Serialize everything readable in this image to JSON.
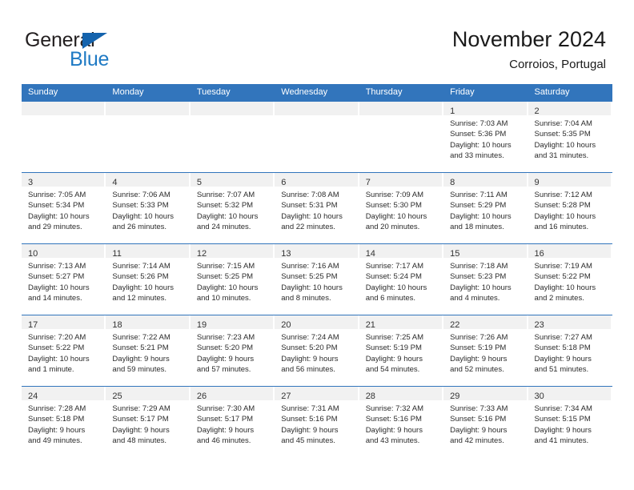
{
  "brand": {
    "name_top": "General",
    "name_bottom": "Blue",
    "triangle_icon": "triangle-icon",
    "color_dark": "#231f20",
    "color_blue": "#1f7ac4"
  },
  "header": {
    "title": "November 2024",
    "subtitle": "Corroios, Portugal"
  },
  "theme": {
    "header_bg": "#3275bc",
    "daynum_bg": "#f1f1f1",
    "cell_bg": "#ffffff",
    "row_divider": "#3275bc",
    "text": "#2b2b2b"
  },
  "weekday_headers": [
    "Sunday",
    "Monday",
    "Tuesday",
    "Wednesday",
    "Thursday",
    "Friday",
    "Saturday"
  ],
  "weeks": [
    [
      {
        "day": "",
        "sunrise": "",
        "sunset": "",
        "daylight_line1": "",
        "daylight_line2": "",
        "empty": true
      },
      {
        "day": "",
        "sunrise": "",
        "sunset": "",
        "daylight_line1": "",
        "daylight_line2": "",
        "empty": true
      },
      {
        "day": "",
        "sunrise": "",
        "sunset": "",
        "daylight_line1": "",
        "daylight_line2": "",
        "empty": true
      },
      {
        "day": "",
        "sunrise": "",
        "sunset": "",
        "daylight_line1": "",
        "daylight_line2": "",
        "empty": true
      },
      {
        "day": "",
        "sunrise": "",
        "sunset": "",
        "daylight_line1": "",
        "daylight_line2": "",
        "empty": true
      },
      {
        "day": "1",
        "sunrise": "Sunrise: 7:03 AM",
        "sunset": "Sunset: 5:36 PM",
        "daylight_line1": "Daylight: 10 hours",
        "daylight_line2": "and 33 minutes."
      },
      {
        "day": "2",
        "sunrise": "Sunrise: 7:04 AM",
        "sunset": "Sunset: 5:35 PM",
        "daylight_line1": "Daylight: 10 hours",
        "daylight_line2": "and 31 minutes."
      }
    ],
    [
      {
        "day": "3",
        "sunrise": "Sunrise: 7:05 AM",
        "sunset": "Sunset: 5:34 PM",
        "daylight_line1": "Daylight: 10 hours",
        "daylight_line2": "and 29 minutes."
      },
      {
        "day": "4",
        "sunrise": "Sunrise: 7:06 AM",
        "sunset": "Sunset: 5:33 PM",
        "daylight_line1": "Daylight: 10 hours",
        "daylight_line2": "and 26 minutes."
      },
      {
        "day": "5",
        "sunrise": "Sunrise: 7:07 AM",
        "sunset": "Sunset: 5:32 PM",
        "daylight_line1": "Daylight: 10 hours",
        "daylight_line2": "and 24 minutes."
      },
      {
        "day": "6",
        "sunrise": "Sunrise: 7:08 AM",
        "sunset": "Sunset: 5:31 PM",
        "daylight_line1": "Daylight: 10 hours",
        "daylight_line2": "and 22 minutes."
      },
      {
        "day": "7",
        "sunrise": "Sunrise: 7:09 AM",
        "sunset": "Sunset: 5:30 PM",
        "daylight_line1": "Daylight: 10 hours",
        "daylight_line2": "and 20 minutes."
      },
      {
        "day": "8",
        "sunrise": "Sunrise: 7:11 AM",
        "sunset": "Sunset: 5:29 PM",
        "daylight_line1": "Daylight: 10 hours",
        "daylight_line2": "and 18 minutes."
      },
      {
        "day": "9",
        "sunrise": "Sunrise: 7:12 AM",
        "sunset": "Sunset: 5:28 PM",
        "daylight_line1": "Daylight: 10 hours",
        "daylight_line2": "and 16 minutes."
      }
    ],
    [
      {
        "day": "10",
        "sunrise": "Sunrise: 7:13 AM",
        "sunset": "Sunset: 5:27 PM",
        "daylight_line1": "Daylight: 10 hours",
        "daylight_line2": "and 14 minutes."
      },
      {
        "day": "11",
        "sunrise": "Sunrise: 7:14 AM",
        "sunset": "Sunset: 5:26 PM",
        "daylight_line1": "Daylight: 10 hours",
        "daylight_line2": "and 12 minutes."
      },
      {
        "day": "12",
        "sunrise": "Sunrise: 7:15 AM",
        "sunset": "Sunset: 5:25 PM",
        "daylight_line1": "Daylight: 10 hours",
        "daylight_line2": "and 10 minutes."
      },
      {
        "day": "13",
        "sunrise": "Sunrise: 7:16 AM",
        "sunset": "Sunset: 5:25 PM",
        "daylight_line1": "Daylight: 10 hours",
        "daylight_line2": "and 8 minutes."
      },
      {
        "day": "14",
        "sunrise": "Sunrise: 7:17 AM",
        "sunset": "Sunset: 5:24 PM",
        "daylight_line1": "Daylight: 10 hours",
        "daylight_line2": "and 6 minutes."
      },
      {
        "day": "15",
        "sunrise": "Sunrise: 7:18 AM",
        "sunset": "Sunset: 5:23 PM",
        "daylight_line1": "Daylight: 10 hours",
        "daylight_line2": "and 4 minutes."
      },
      {
        "day": "16",
        "sunrise": "Sunrise: 7:19 AM",
        "sunset": "Sunset: 5:22 PM",
        "daylight_line1": "Daylight: 10 hours",
        "daylight_line2": "and 2 minutes."
      }
    ],
    [
      {
        "day": "17",
        "sunrise": "Sunrise: 7:20 AM",
        "sunset": "Sunset: 5:22 PM",
        "daylight_line1": "Daylight: 10 hours",
        "daylight_line2": "and 1 minute."
      },
      {
        "day": "18",
        "sunrise": "Sunrise: 7:22 AM",
        "sunset": "Sunset: 5:21 PM",
        "daylight_line1": "Daylight: 9 hours",
        "daylight_line2": "and 59 minutes."
      },
      {
        "day": "19",
        "sunrise": "Sunrise: 7:23 AM",
        "sunset": "Sunset: 5:20 PM",
        "daylight_line1": "Daylight: 9 hours",
        "daylight_line2": "and 57 minutes."
      },
      {
        "day": "20",
        "sunrise": "Sunrise: 7:24 AM",
        "sunset": "Sunset: 5:20 PM",
        "daylight_line1": "Daylight: 9 hours",
        "daylight_line2": "and 56 minutes."
      },
      {
        "day": "21",
        "sunrise": "Sunrise: 7:25 AM",
        "sunset": "Sunset: 5:19 PM",
        "daylight_line1": "Daylight: 9 hours",
        "daylight_line2": "and 54 minutes."
      },
      {
        "day": "22",
        "sunrise": "Sunrise: 7:26 AM",
        "sunset": "Sunset: 5:19 PM",
        "daylight_line1": "Daylight: 9 hours",
        "daylight_line2": "and 52 minutes."
      },
      {
        "day": "23",
        "sunrise": "Sunrise: 7:27 AM",
        "sunset": "Sunset: 5:18 PM",
        "daylight_line1": "Daylight: 9 hours",
        "daylight_line2": "and 51 minutes."
      }
    ],
    [
      {
        "day": "24",
        "sunrise": "Sunrise: 7:28 AM",
        "sunset": "Sunset: 5:18 PM",
        "daylight_line1": "Daylight: 9 hours",
        "daylight_line2": "and 49 minutes."
      },
      {
        "day": "25",
        "sunrise": "Sunrise: 7:29 AM",
        "sunset": "Sunset: 5:17 PM",
        "daylight_line1": "Daylight: 9 hours",
        "daylight_line2": "and 48 minutes."
      },
      {
        "day": "26",
        "sunrise": "Sunrise: 7:30 AM",
        "sunset": "Sunset: 5:17 PM",
        "daylight_line1": "Daylight: 9 hours",
        "daylight_line2": "and 46 minutes."
      },
      {
        "day": "27",
        "sunrise": "Sunrise: 7:31 AM",
        "sunset": "Sunset: 5:16 PM",
        "daylight_line1": "Daylight: 9 hours",
        "daylight_line2": "and 45 minutes."
      },
      {
        "day": "28",
        "sunrise": "Sunrise: 7:32 AM",
        "sunset": "Sunset: 5:16 PM",
        "daylight_line1": "Daylight: 9 hours",
        "daylight_line2": "and 43 minutes."
      },
      {
        "day": "29",
        "sunrise": "Sunrise: 7:33 AM",
        "sunset": "Sunset: 5:16 PM",
        "daylight_line1": "Daylight: 9 hours",
        "daylight_line2": "and 42 minutes."
      },
      {
        "day": "30",
        "sunrise": "Sunrise: 7:34 AM",
        "sunset": "Sunset: 5:15 PM",
        "daylight_line1": "Daylight: 9 hours",
        "daylight_line2": "and 41 minutes."
      }
    ]
  ]
}
